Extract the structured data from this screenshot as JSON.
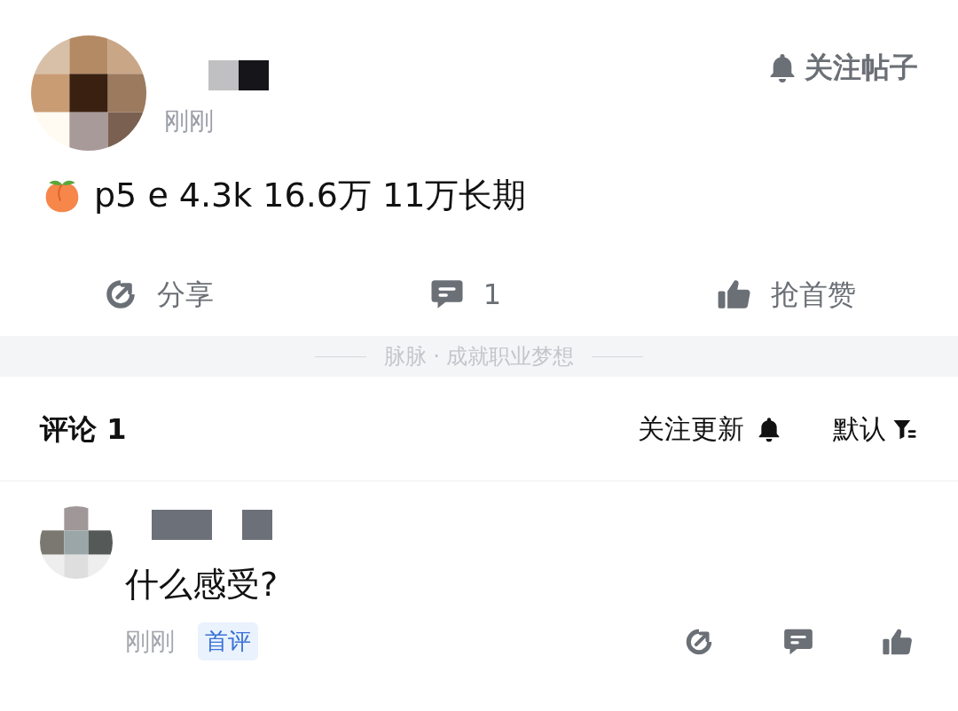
{
  "post": {
    "follow_button": "关注帖子",
    "time": "刚刚",
    "text": "p5 e 4.3k 16.6万 11万长期",
    "actions": [
      {
        "kind": "share",
        "label": "分享"
      },
      {
        "kind": "comment",
        "label": "1"
      },
      {
        "kind": "like",
        "label": "抢首赞"
      }
    ]
  },
  "slogan": "脉脉 · 成就职业梦想",
  "comments_header": {
    "title": "评论 1",
    "follow_updates": "关注更新",
    "sort": "默认"
  },
  "comments": [
    {
      "text": "什么感受?",
      "time": "刚刚",
      "badge": "首评",
      "actions": [
        {
          "kind": "share"
        },
        {
          "kind": "comment"
        },
        {
          "kind": "like"
        }
      ]
    }
  ]
}
